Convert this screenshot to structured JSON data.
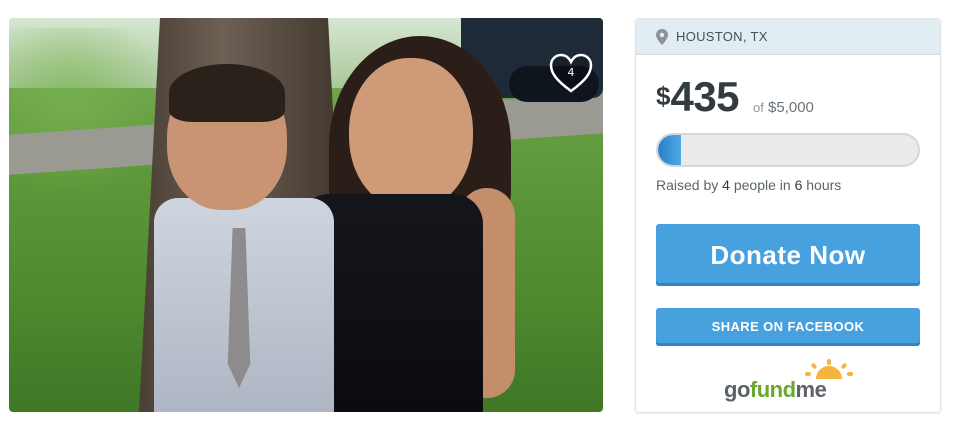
{
  "photo": {
    "heart_count": "4"
  },
  "campaign": {
    "location": "HOUSTON, TX",
    "currency_symbol": "$",
    "amount_raised": "435",
    "goal_prefix": "of",
    "goal": "$5,000",
    "progress_fraction": 0.087,
    "raised_by_prefix": "Raised by",
    "people_count": "4",
    "people_label": "people in",
    "hours_count": "6",
    "hours_label": "hours"
  },
  "buttons": {
    "donate_label": "Donate Now",
    "share_label": "SHARE ON FACEBOOK"
  },
  "logo": {
    "go": "go",
    "fund": "fund",
    "me": "me"
  },
  "colors": {
    "accent": "#47a1df",
    "header_bg": "#e2edf3",
    "brand_green": "#6aa72d"
  }
}
